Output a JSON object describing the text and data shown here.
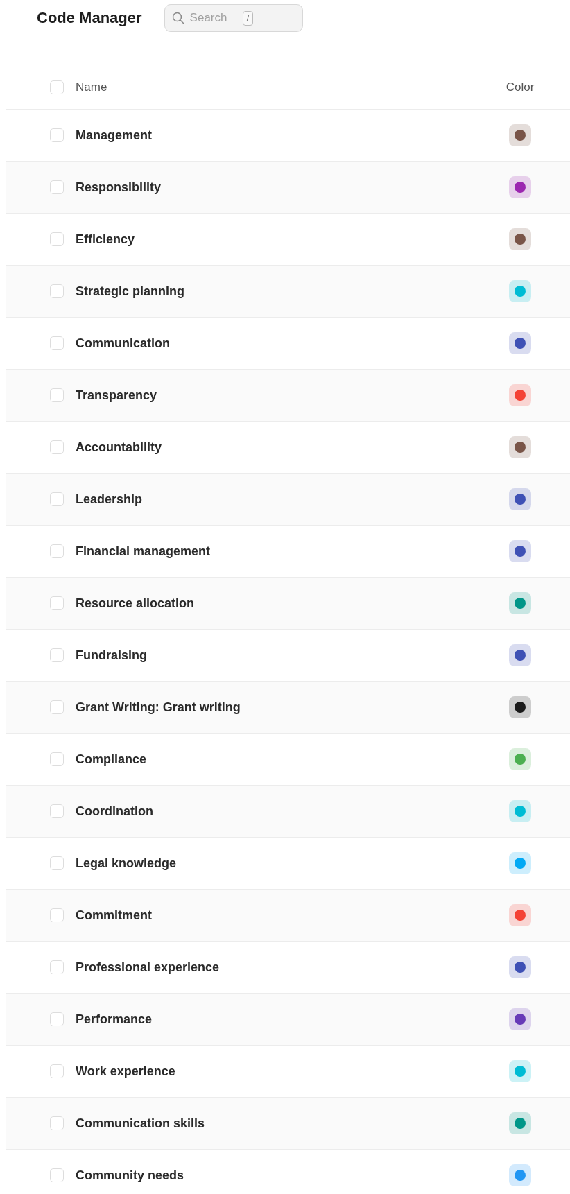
{
  "title": "Code Manager",
  "search": {
    "placeholder": "Search",
    "shortcut": "/"
  },
  "table": {
    "select_all": {
      "checked": false
    },
    "columns": [
      "Name",
      "Color"
    ],
    "rows": [
      {
        "name": "Management",
        "color": "#795548",
        "checked": false
      },
      {
        "name": "Responsibility",
        "color": "#9c27b0",
        "checked": false
      },
      {
        "name": "Efficiency",
        "color": "#795548",
        "checked": false
      },
      {
        "name": "Strategic planning",
        "color": "#00bcd4",
        "checked": false
      },
      {
        "name": "Communication",
        "color": "#3f51b5",
        "checked": false
      },
      {
        "name": "Transparency",
        "color": "#f44336",
        "checked": false
      },
      {
        "name": "Accountability",
        "color": "#795548",
        "checked": false
      },
      {
        "name": "Leadership",
        "color": "#3f51b5",
        "checked": false
      },
      {
        "name": "Financial management",
        "color": "#3f51b5",
        "checked": false
      },
      {
        "name": "Resource allocation",
        "color": "#009688",
        "checked": false
      },
      {
        "name": "Fundraising",
        "color": "#3f51b5",
        "checked": false
      },
      {
        "name": "Grant Writing: Grant writing",
        "color": "#1a1a1a",
        "checked": false
      },
      {
        "name": "Compliance",
        "color": "#4caf50",
        "checked": false
      },
      {
        "name": "Coordination",
        "color": "#00bcd4",
        "checked": false
      },
      {
        "name": "Legal knowledge",
        "color": "#03a9f4",
        "checked": false
      },
      {
        "name": "Commitment",
        "color": "#f44336",
        "checked": false
      },
      {
        "name": "Professional experience",
        "color": "#3f51b5",
        "checked": false
      },
      {
        "name": "Performance",
        "color": "#673ab7",
        "checked": false
      },
      {
        "name": "Work experience",
        "color": "#00bcd4",
        "checked": false
      },
      {
        "name": "Communication skills",
        "color": "#009688",
        "checked": false
      },
      {
        "name": "Community needs",
        "color": "#2196f3",
        "checked": false
      }
    ]
  }
}
